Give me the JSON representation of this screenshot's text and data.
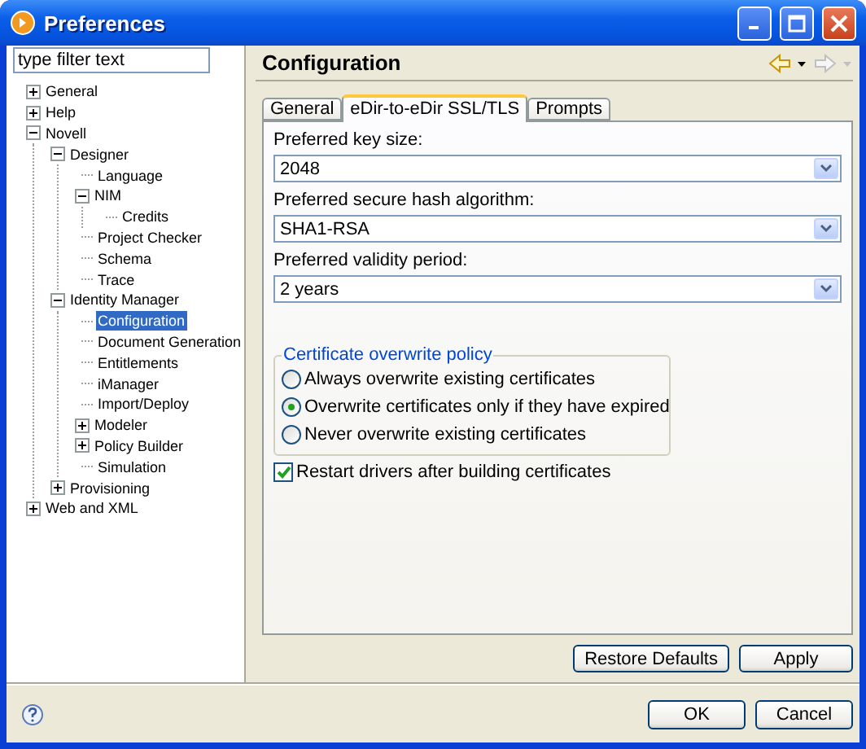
{
  "window": {
    "title": "Preferences"
  },
  "filter": {
    "placeholder": "type filter text"
  },
  "tree": [
    {
      "label": "General",
      "selected": false,
      "expanded": false
    },
    {
      "label": "Help",
      "selected": false,
      "expanded": false
    },
    {
      "label": "Novell",
      "selected": false,
      "expanded": true,
      "children": [
        {
          "label": "Designer",
          "selected": false,
          "expanded": true,
          "children": [
            {
              "label": "Language",
              "selected": false
            },
            {
              "label": "NIM",
              "selected": false,
              "expanded": true,
              "children": [
                {
                  "label": "Credits",
                  "selected": false
                }
              ]
            },
            {
              "label": "Project Checker",
              "selected": false
            },
            {
              "label": "Schema",
              "selected": false
            },
            {
              "label": "Trace",
              "selected": false
            }
          ]
        },
        {
          "label": "Identity Manager",
          "selected": false,
          "expanded": true,
          "children": [
            {
              "label": "Configuration",
              "selected": true
            },
            {
              "label": "Document Generation",
              "selected": false
            },
            {
              "label": "Entitlements",
              "selected": false
            },
            {
              "label": "iManager",
              "selected": false
            },
            {
              "label": "Import/Deploy",
              "selected": false
            },
            {
              "label": "Modeler",
              "selected": false,
              "expanded": false
            },
            {
              "label": "Policy Builder",
              "selected": false,
              "expanded": false
            },
            {
              "label": "Simulation",
              "selected": false
            }
          ]
        },
        {
          "label": "Provisioning",
          "selected": false,
          "expanded": false
        }
      ]
    },
    {
      "label": "Web and XML",
      "selected": false,
      "expanded": false
    }
  ],
  "page": {
    "title": "Configuration"
  },
  "tabs": [
    {
      "label": "General",
      "selected": false
    },
    {
      "label": "eDir-to-eDir SSL/TLS",
      "selected": true
    },
    {
      "label": "Prompts",
      "selected": false
    }
  ],
  "fields": [
    {
      "label": "Preferred key size:",
      "value": "2048"
    },
    {
      "label": "Preferred secure hash algorithm:",
      "value": "SHA1-RSA"
    },
    {
      "label": "Preferred validity period:",
      "value": "2 years"
    }
  ],
  "group": {
    "title": "Certificate overwrite policy",
    "options": [
      {
        "label": "Always overwrite existing certificates",
        "selected": false
      },
      {
        "label": "Overwrite certificates only if they have expired",
        "selected": true
      },
      {
        "label": "Never overwrite existing certificates",
        "selected": false
      }
    ]
  },
  "checkbox": {
    "label": "Restart drivers after building certificates",
    "checked": true
  },
  "page_buttons": [
    "Restore Defaults",
    "Apply"
  ],
  "dialog_buttons": [
    "OK",
    "Cancel"
  ]
}
